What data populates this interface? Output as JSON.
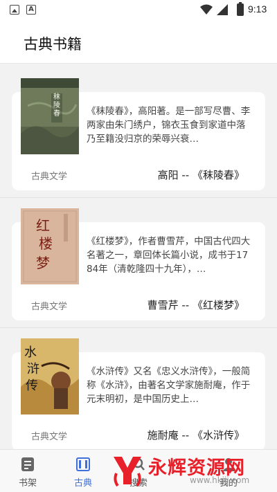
{
  "status_bar": {
    "time": "9:13"
  },
  "app_bar": {
    "title": "古典书籍"
  },
  "books": [
    {
      "description": "《秣陵春》，高阳著。是一部写尽曹、李两家由朱门绣户，锦衣玉食到家道中落乃至籍没归京的荣辱兴衰…",
      "category": "古典文学",
      "author_title": "高阳 -- 《秣陵春》",
      "cover_text": "秣陵春"
    },
    {
      "description": "《红楼梦》，作者曹雪芹，中国古代四大名著之一，章回体长篇小说，成书于1784年（清乾隆四十九年），…",
      "category": "古典文学",
      "author_title": "曹雪芹 -- 《红楼梦》",
      "cover_text": "红楼梦"
    },
    {
      "description": "《水浒传》又名《忠义水浒传》，一般简称《水浒》，由著名文学家施耐庵，作于元末明初，是中国历史上…",
      "category": "古典文学",
      "author_title": "施耐庵 -- 《水浒传》",
      "cover_text": "水浒传"
    }
  ],
  "bottom_nav": {
    "items": [
      {
        "label": "书架",
        "icon": "document-icon"
      },
      {
        "label": "古典",
        "icon": "book-open-icon"
      },
      {
        "label": "搜索",
        "icon": "search-icon"
      },
      {
        "label": "我的",
        "icon": "person-icon"
      }
    ],
    "active_index": 1
  },
  "watermark": {
    "text": "永辉资源网",
    "url": "www.hkjjj.com"
  },
  "colors": {
    "accent": "#3f6fd8",
    "watermark": "#e8202a"
  }
}
